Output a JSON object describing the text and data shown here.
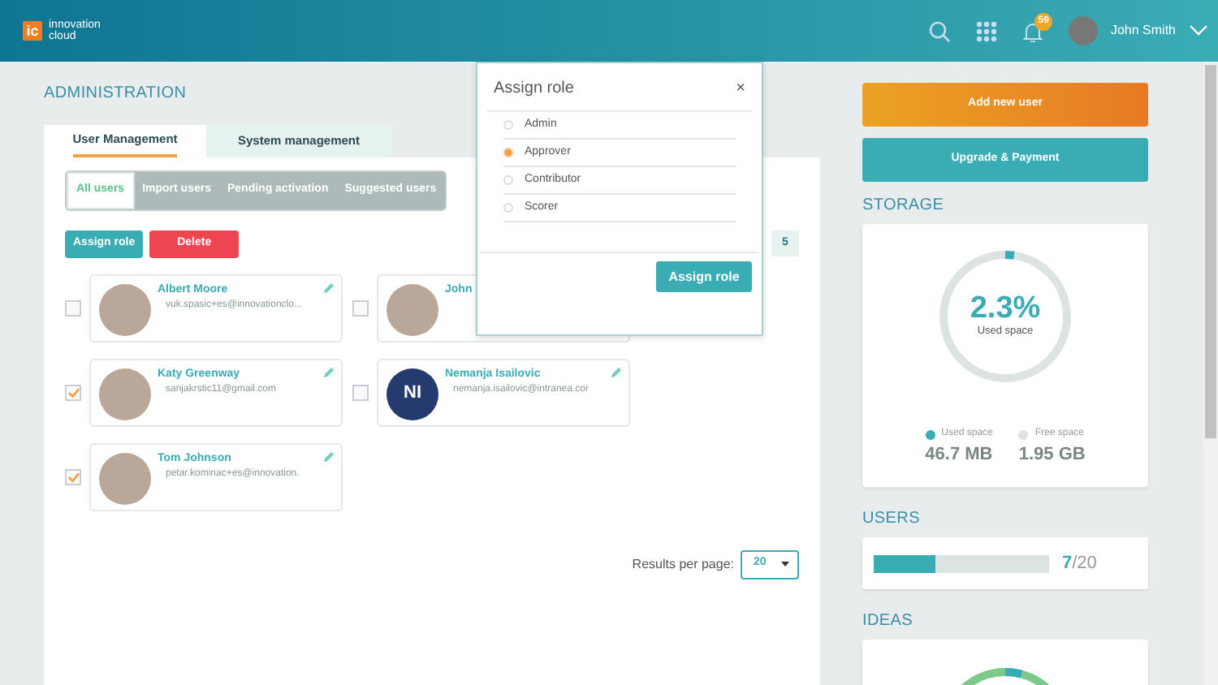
{
  "header": {
    "logo_mark": "ic",
    "logo_text": [
      "innovation",
      "cloud"
    ],
    "notification_count": "59",
    "user_name": "John Smith"
  },
  "page_title": "ADMINISTRATION",
  "tabs": [
    {
      "label": "User Management",
      "selected": true
    },
    {
      "label": "System management",
      "selected": false
    }
  ],
  "filters": [
    {
      "label": "All users",
      "selected": true
    },
    {
      "label": "Import users",
      "selected": false
    },
    {
      "label": "Pending activation",
      "selected": false
    },
    {
      "label": "Suggested users",
      "selected": false
    }
  ],
  "actions": [
    {
      "label": "Assign role",
      "kind": "primary"
    },
    {
      "label": "Delete",
      "kind": "danger"
    }
  ],
  "total_count": "5",
  "users": [
    {
      "name": "Albert Moore",
      "email": "vuk.spasic+es@innovationclo...",
      "checked": false,
      "kind": "photo"
    },
    {
      "name": "John",
      "checked": false,
      "kind": "photo"
    },
    {
      "name": "Katy Greenway",
      "email": "sanjakrstic11@gmail.com",
      "checked": true,
      "kind": "photo"
    },
    {
      "name": "Nemanja Isailovic",
      "email": "nemanja.isailovic@intranea.cor",
      "checked": false,
      "kind": "initials",
      "initials": "NI"
    },
    {
      "name": "Tom Johnson",
      "email": "petar.kominac+es@innovation.",
      "checked": true,
      "kind": "photo"
    }
  ],
  "pagination": {
    "label": "Results per page:",
    "value": "20"
  },
  "modal": {
    "title": "Assign role",
    "close": "×",
    "roles": [
      {
        "label": "Admin",
        "selected": false
      },
      {
        "label": "Approver",
        "selected": true
      },
      {
        "label": "Contributor",
        "selected": false
      },
      {
        "label": "Scorer",
        "selected": false
      }
    ],
    "button": "Assign role"
  },
  "sidebar": {
    "buttons": [
      {
        "label": "Add new user",
        "kind": "accent"
      },
      {
        "label": "Upgrade & Payment",
        "kind": "primary"
      }
    ],
    "storage": {
      "title": "STORAGE",
      "percent": "2.3%",
      "caption": "Used space",
      "level": 0.023,
      "legend": [
        {
          "label": "Used space",
          "value": "46.7 MB",
          "color": "#3aacb4"
        },
        {
          "label": "Free space",
          "value": "1.95 GB",
          "color": "#dde3e3"
        }
      ]
    },
    "users": {
      "title": "USERS",
      "level": 0.35,
      "count": "7",
      "total": "/20"
    },
    "ideas": {
      "title": "IDEAS"
    }
  }
}
